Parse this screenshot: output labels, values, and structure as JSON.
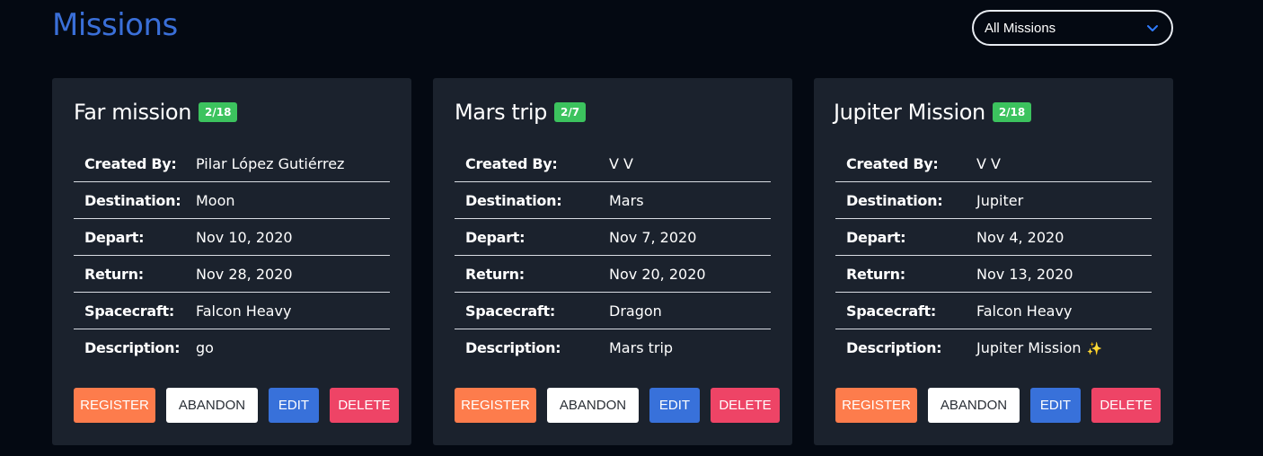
{
  "header": {
    "title": "Missions",
    "title_color": "#3a6fd8",
    "filter": {
      "selected": "All Missions",
      "icon": "chevron-down-icon",
      "icon_color": "#2f7bff"
    }
  },
  "colors": {
    "background": "#040912",
    "card": "#1b222d",
    "badge": "#3cc35e",
    "register": "#fd7c4c",
    "abandon": "#ffffff",
    "edit": "#3871da",
    "delete": "#ee4466"
  },
  "field_labels": {
    "created_by": "Created By:",
    "destination": "Destination:",
    "depart": "Depart:",
    "return": "Return:",
    "spacecraft": "Spacecraft:",
    "description": "Description:"
  },
  "buttons": {
    "register": "REGISTER",
    "abandon": "ABANDON",
    "edit": "EDIT",
    "delete": "DELETE"
  },
  "missions": [
    {
      "title": "Far mission",
      "badge": "2/18",
      "created_by": "Pilar López Gutiérrez",
      "destination": "Moon",
      "depart": "Nov 10, 2020",
      "return": "Nov 28, 2020",
      "spacecraft": "Falcon Heavy",
      "description": "go",
      "description_emoji": ""
    },
    {
      "title": "Mars trip",
      "badge": "2/7",
      "created_by": "V V",
      "destination": "Mars",
      "depart": "Nov 7, 2020",
      "return": "Nov 20, 2020",
      "spacecraft": "Dragon",
      "description": "Mars trip",
      "description_emoji": ""
    },
    {
      "title": "Jupiter Mission",
      "badge": "2/18",
      "created_by": "V V",
      "destination": "Jupiter",
      "depart": "Nov 4, 2020",
      "return": "Nov 13, 2020",
      "spacecraft": "Falcon Heavy",
      "description": "Jupiter Mission",
      "description_emoji": "✨"
    }
  ]
}
